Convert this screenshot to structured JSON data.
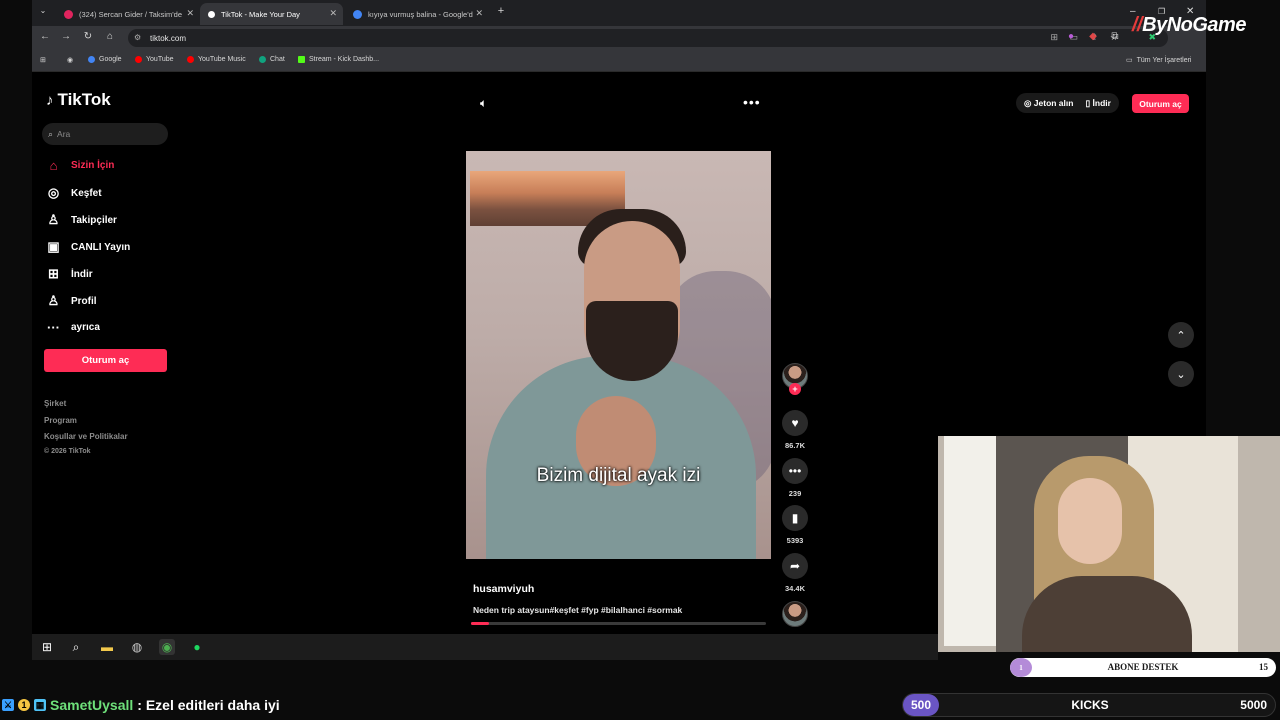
{
  "browser": {
    "tabs": [
      {
        "title": "(324) Sercan Gider / Taksim'de",
        "favicon_color": "#e0245e",
        "active": false
      },
      {
        "title": "TikTok - Make Your Day",
        "favicon_color": "#ffffff",
        "active": true
      },
      {
        "title": "kıyıya vurmuş balina - Google'd",
        "favicon_color": "#4285f4",
        "active": false
      }
    ],
    "new_tab": "+",
    "url": "tiktok.com",
    "bookmarks": [
      {
        "label": "Google",
        "color": "#4285f4"
      },
      {
        "label": "YouTube",
        "color": "#ff0000"
      },
      {
        "label": "YouTube Music",
        "color": "#ff0000"
      },
      {
        "label": "Chat",
        "color": "#10a37f"
      },
      {
        "label": "Stream - Kick Dashb...",
        "color": "#53fc18"
      }
    ],
    "all_bookmarks": "Tüm Yer İşaretleri"
  },
  "watermark": {
    "brand_a": "By",
    "brand_b": "NoGame"
  },
  "tiktok": {
    "logo": "TikTok",
    "search_placeholder": "Ara",
    "nav": [
      {
        "label": "Sizin İçin",
        "icon": "home-icon",
        "active": true
      },
      {
        "label": "Keşfet",
        "icon": "compass-icon",
        "active": false
      },
      {
        "label": "Takipçiler",
        "icon": "followers-icon",
        "active": false
      },
      {
        "label": "CANLI Yayın",
        "icon": "live-icon",
        "active": false
      },
      {
        "label": "İndir",
        "icon": "download-icon",
        "active": false
      },
      {
        "label": "Profil",
        "icon": "profile-icon",
        "active": false
      },
      {
        "label": "ayrıca",
        "icon": "more-dots-icon",
        "active": false
      }
    ],
    "login_label": "Oturum aç",
    "footer": [
      "Şirket",
      "Program",
      "Koşullar ve Politikalar",
      "© 2026 TikTok"
    ],
    "top": {
      "coins": "Jeton alın",
      "download": "İndir",
      "login": "Oturum aç"
    },
    "video": {
      "caption": "Bizim dijital ayak izi",
      "author": "husamviyuh",
      "description": "Neden trip ataysun#keşfet #fyp #bilalhanci #sormak",
      "progress": 0.06
    },
    "actions": {
      "likes": "86.7K",
      "comments": "239",
      "saves": "5393",
      "shares": "34.4K"
    }
  },
  "stream": {
    "abone": {
      "current": "1",
      "label": "ABONE DESTEK",
      "goal": "15"
    },
    "kicks": {
      "current": "500",
      "label": "KICKS",
      "goal": "5000"
    },
    "chat": {
      "user": "SametUysall",
      "message": ": Ezel editleri daha iyi"
    }
  }
}
